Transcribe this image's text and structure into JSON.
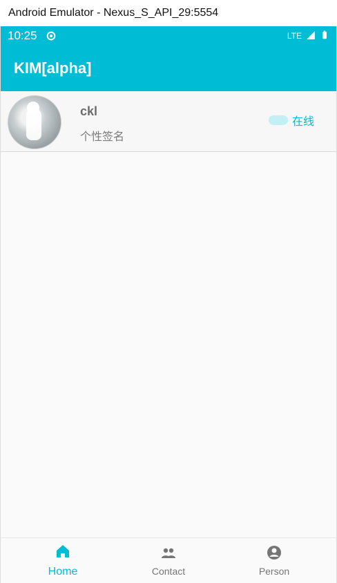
{
  "window": {
    "title": "Android Emulator - Nexus_S_API_29:5554"
  },
  "statusbar": {
    "time": "10:25",
    "network": "LTE"
  },
  "appbar": {
    "title": "KIM[alpha]"
  },
  "contacts": [
    {
      "name": "ckl",
      "signature": "个性签名",
      "status": "在线"
    }
  ],
  "bottom_nav": {
    "home": "Home",
    "contact": "Contact",
    "person": "Person"
  },
  "colors": {
    "accent": "#00bcd4"
  }
}
